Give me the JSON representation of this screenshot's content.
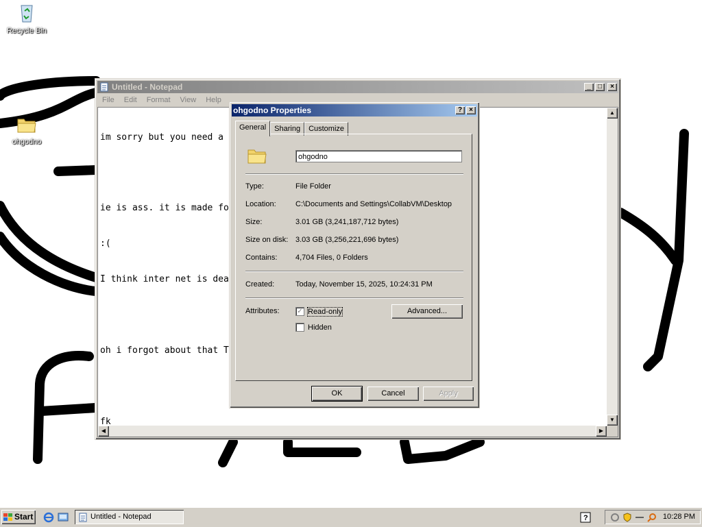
{
  "desktop": {
    "icons": [
      {
        "label": "Recycle Bin",
        "icon": "recycle-bin-icon"
      },
      {
        "label": "ohgodno",
        "icon": "folder-icon"
      }
    ]
  },
  "notepad": {
    "title": "Untitled - Notepad",
    "menu": [
      "File",
      "Edit",
      "Format",
      "View",
      "Help"
    ],
    "lines": [
      "im sorry but you need a",
      "",
      "ie is ass. it is made fo",
      ":(",
      "I think inter net is dea",
      "",
      "oh i forgot about that T",
      "",
      "fk"
    ]
  },
  "properties": {
    "title": "ohgodno Properties",
    "help_button": "?",
    "close_button": "×",
    "tabs": [
      "General",
      "Sharing",
      "Customize"
    ],
    "name_value": "ohgodno",
    "fields": {
      "type_label": "Type:",
      "type_value": "File Folder",
      "location_label": "Location:",
      "location_value": "C:\\Documents and Settings\\CollabVM\\Desktop",
      "size_label": "Size:",
      "size_value": "3.01 GB (3,241,187,712 bytes)",
      "size_on_disk_label": "Size on disk:",
      "size_on_disk_value": "3.03 GB (3,256,221,696 bytes)",
      "contains_label": "Contains:",
      "contains_value": "4,704 Files, 0 Folders",
      "created_label": "Created:",
      "created_value": "Today, November 15, 2025, 10:24:31 PM",
      "attributes_label": "Attributes:"
    },
    "attributes": {
      "readonly_label": "Read-only",
      "readonly_checked": true,
      "hidden_label": "Hidden",
      "hidden_checked": false
    },
    "advanced_button": "Advanced...",
    "ok_button": "OK",
    "cancel_button": "Cancel",
    "apply_button": "Apply"
  },
  "taskbar": {
    "start_label": "Start",
    "task_label": "Untitled - Notepad",
    "clock": "10:28 PM"
  },
  "colors": {
    "active_title": "#0a246a",
    "window_face": "#d4d0c8"
  }
}
